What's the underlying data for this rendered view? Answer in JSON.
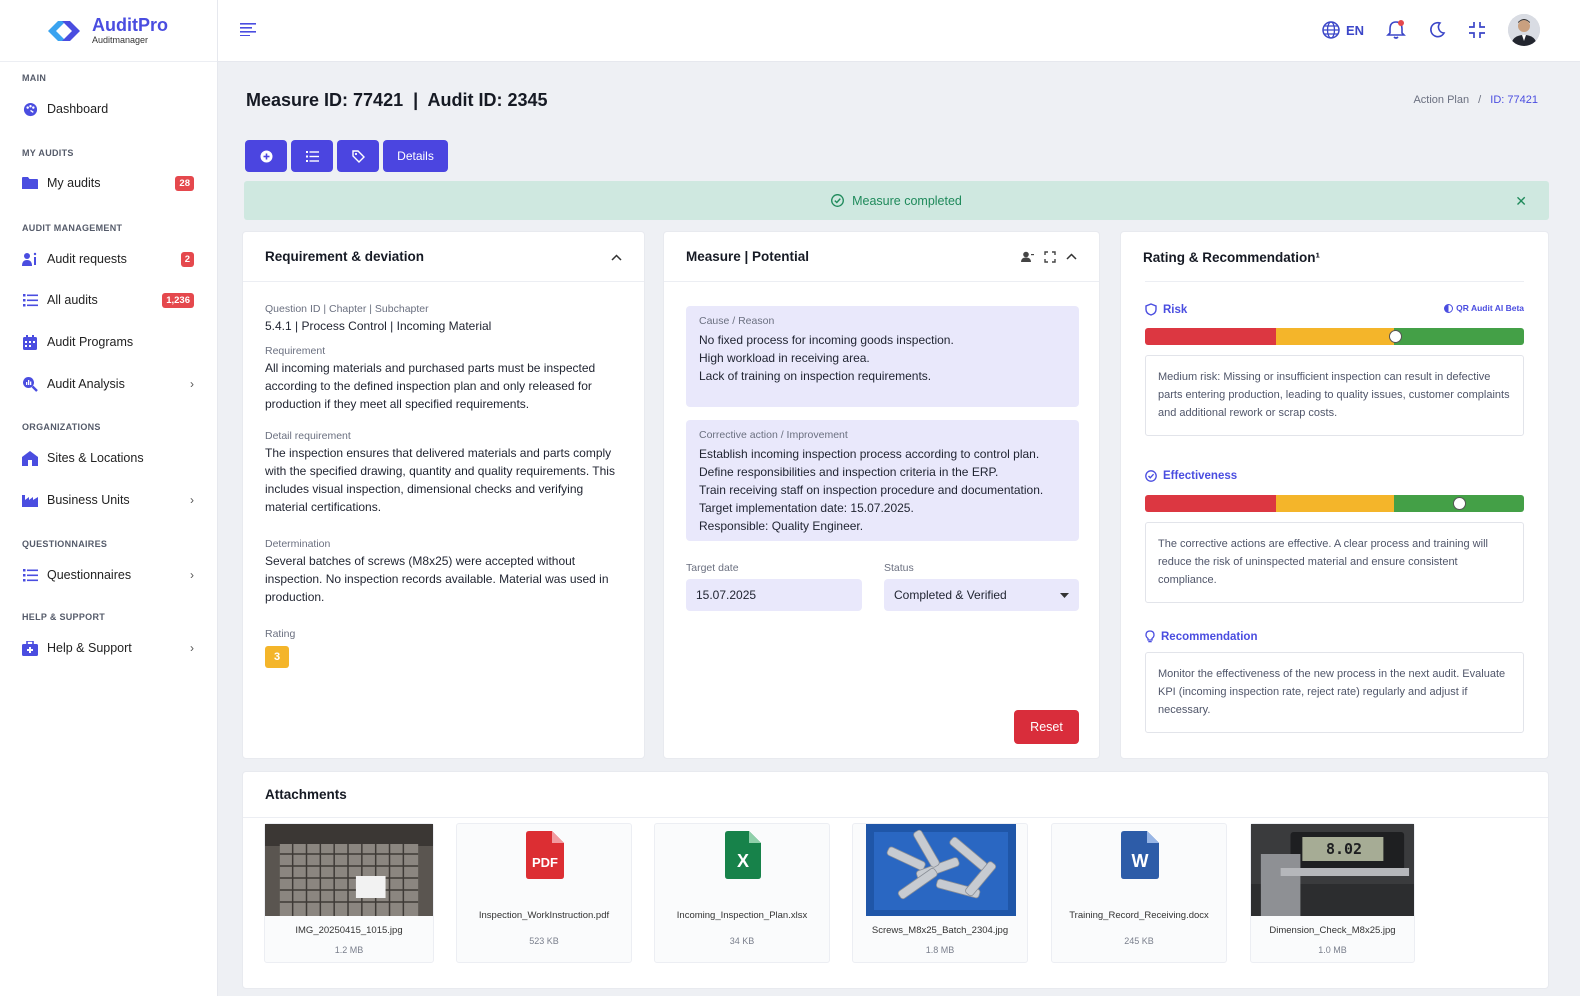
{
  "brand": {
    "name": "AuditPro",
    "sub": "Auditmanager"
  },
  "sidebar": {
    "sections": {
      "main": "MAIN",
      "my_audits": "MY AUDITS",
      "audit_management": "AUDIT MANAGEMENT",
      "organizations": "ORGANIZATIONS",
      "questionnaires": "QUESTIONNAIRES",
      "help": "HELP & SUPPORT"
    },
    "items": {
      "dashboard": {
        "label": "Dashboard"
      },
      "my_audits": {
        "label": "My audits",
        "badge": "28"
      },
      "audit_requests": {
        "label": "Audit requests",
        "badge": "2"
      },
      "all_audits": {
        "label": "All audits",
        "badge": "1,236"
      },
      "audit_programs": {
        "label": "Audit Programs"
      },
      "audit_analysis": {
        "label": "Audit Analysis"
      },
      "sites": {
        "label": "Sites & Locations"
      },
      "business_units": {
        "label": "Business Units"
      },
      "questionnaires": {
        "label": "Questionnaires"
      },
      "help": {
        "label": "Help & Support"
      }
    }
  },
  "topbar": {
    "language": "EN"
  },
  "page": {
    "title": "Measure ID: 77421  |  Audit ID: 2345",
    "breadcrumb": {
      "parent": "Action Plan",
      "separator": "/",
      "current": "ID: 77421"
    },
    "toolbar": {
      "details_label": "Details"
    },
    "alert": "Measure completed"
  },
  "requirement_card": {
    "title": "Requirement & deviation",
    "question_label": "Question ID | Chapter | Subchapter",
    "question_value": "5.4.1 | Process Control | Incoming Material",
    "requirement_label": "Requirement",
    "requirement_value": "All incoming materials and purchased parts must be inspected according to the defined inspection plan and only released for production if they meet all specified requirements.",
    "detail_label": "Detail requirement",
    "detail_value": "The inspection ensures that delivered materials and parts comply with the specified drawing, quantity and quality requirements. This includes visual inspection, dimensional checks and verifying material certifications.",
    "determination_label": "Determination",
    "determination_value": "Several batches of screws (M8x25) were accepted without inspection. No inspection records available. Material was used in production.",
    "rating_label": "Rating",
    "rating_value": "3"
  },
  "measure_card": {
    "title": "Measure | Potential",
    "cause_label": "Cause / Reason",
    "cause_lines": [
      "No fixed process for incoming goods inspection.",
      "High workload in receiving area.",
      "Lack of training on inspection requirements."
    ],
    "action_label": "Corrective action / Improvement",
    "action_lines": [
      "Establish incoming inspection process according to control plan.",
      "Define responsibilities and inspection criteria in the ERP.",
      "Train receiving staff on inspection procedure and documentation.",
      "Target implementation date: 15.07.2025.",
      "Responsible: Quality Engineer."
    ],
    "target_label": "Target date",
    "target_value": "15.07.2025",
    "status_label": "Status",
    "status_value": "Completed & Verified",
    "reset_label": "Reset"
  },
  "rating_card": {
    "title": "Rating & Recommendation¹",
    "risk_label": "Risk",
    "ai_label": "QR Audit AI Beta",
    "risk_level": 0.66,
    "risk_text": "Medium risk: Missing or insufficient inspection can result in defective parts entering production, leading to quality issues, customer complaints and additional rework or scrap costs.",
    "effectiveness_label": "Effectiveness",
    "effectiveness_level": 0.83,
    "effectiveness_text": "The corrective actions are effective. A clear process and training will reduce the risk of uninspected material and ensure consistent compliance.",
    "recommendation_label": "Recommendation",
    "recommendation_text": "Monitor the effectiveness of the new process in the next audit. Evaluate KPI (incoming inspection rate, reject rate) regularly and adjust if necessary.",
    "colors": {
      "red": "#dc3741",
      "yellow": "#f4b52a",
      "green": "#44a047"
    }
  },
  "attachments": {
    "title": "Attachments",
    "files": [
      {
        "name": "IMG_20250415_1015.jpg",
        "size": "1.2 MB",
        "type": "photo"
      },
      {
        "name": "Inspection_WorkInstruction.pdf",
        "size": "523 KB",
        "type": "pdf",
        "icon_text": "PDF"
      },
      {
        "name": "Incoming_Inspection_Plan.xlsx",
        "size": "34 KB",
        "type": "xlsx",
        "icon_text": "X"
      },
      {
        "name": "Screws_M8x25_Batch_2304.jpg",
        "size": "1.8 MB",
        "type": "photo"
      },
      {
        "name": "Training_Record_Receiving.docx",
        "size": "245 KB",
        "type": "docx",
        "icon_text": "W"
      },
      {
        "name": "Dimension_Check_M8x25.jpg",
        "size": "1.0 MB",
        "type": "photo",
        "display_text": "8.02"
      }
    ]
  }
}
